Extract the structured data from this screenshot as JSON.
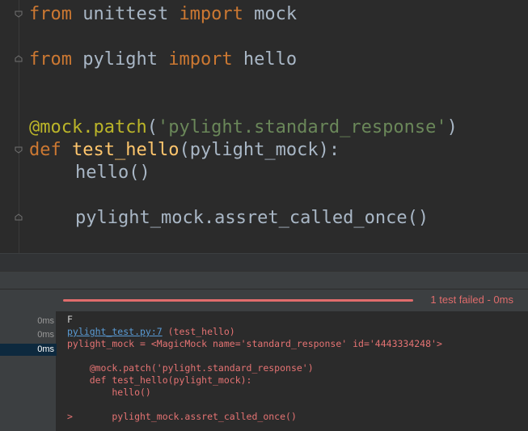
{
  "editor": {
    "lines": [
      {
        "kw1": "from",
        "mod": " unittest ",
        "kw2": "import",
        "name": " mock"
      },
      {
        "kw1": "from",
        "mod": " pylight ",
        "kw2": "import",
        "name": " hello"
      },
      {
        "decorator": "@mock.patch",
        "open": "(",
        "string": "'pylight.standard_response'",
        "close": ")"
      },
      {
        "kw": "def",
        "fn": "test_hello",
        "args": "(pylight_mock):"
      },
      {
        "body": "hello()"
      },
      {
        "body": "pylight_mock.assret_called_once()"
      }
    ]
  },
  "test_run": {
    "status": "1 test failed - 0ms",
    "progress_percent": 100
  },
  "timings": [
    "0ms",
    "0ms",
    "0ms"
  ],
  "output": {
    "result_char": "F",
    "file_link": "pylight_test.py:7",
    "test_name": " (test_hello)",
    "mock_line": "pylight_mock = <MagicMock name='standard_response' id='4443334248'>",
    "traceback": [
      "    @mock.patch('pylight.standard_response')",
      "    def test_hello(pylight_mock):",
      "        hello()",
      "",
      ">       pylight_mock.assret_called_once()"
    ]
  },
  "colors": {
    "keyword": "#cc7832",
    "decorator": "#bbb529",
    "string": "#6a8759",
    "function": "#ffc66d",
    "error": "#e06c6c"
  }
}
